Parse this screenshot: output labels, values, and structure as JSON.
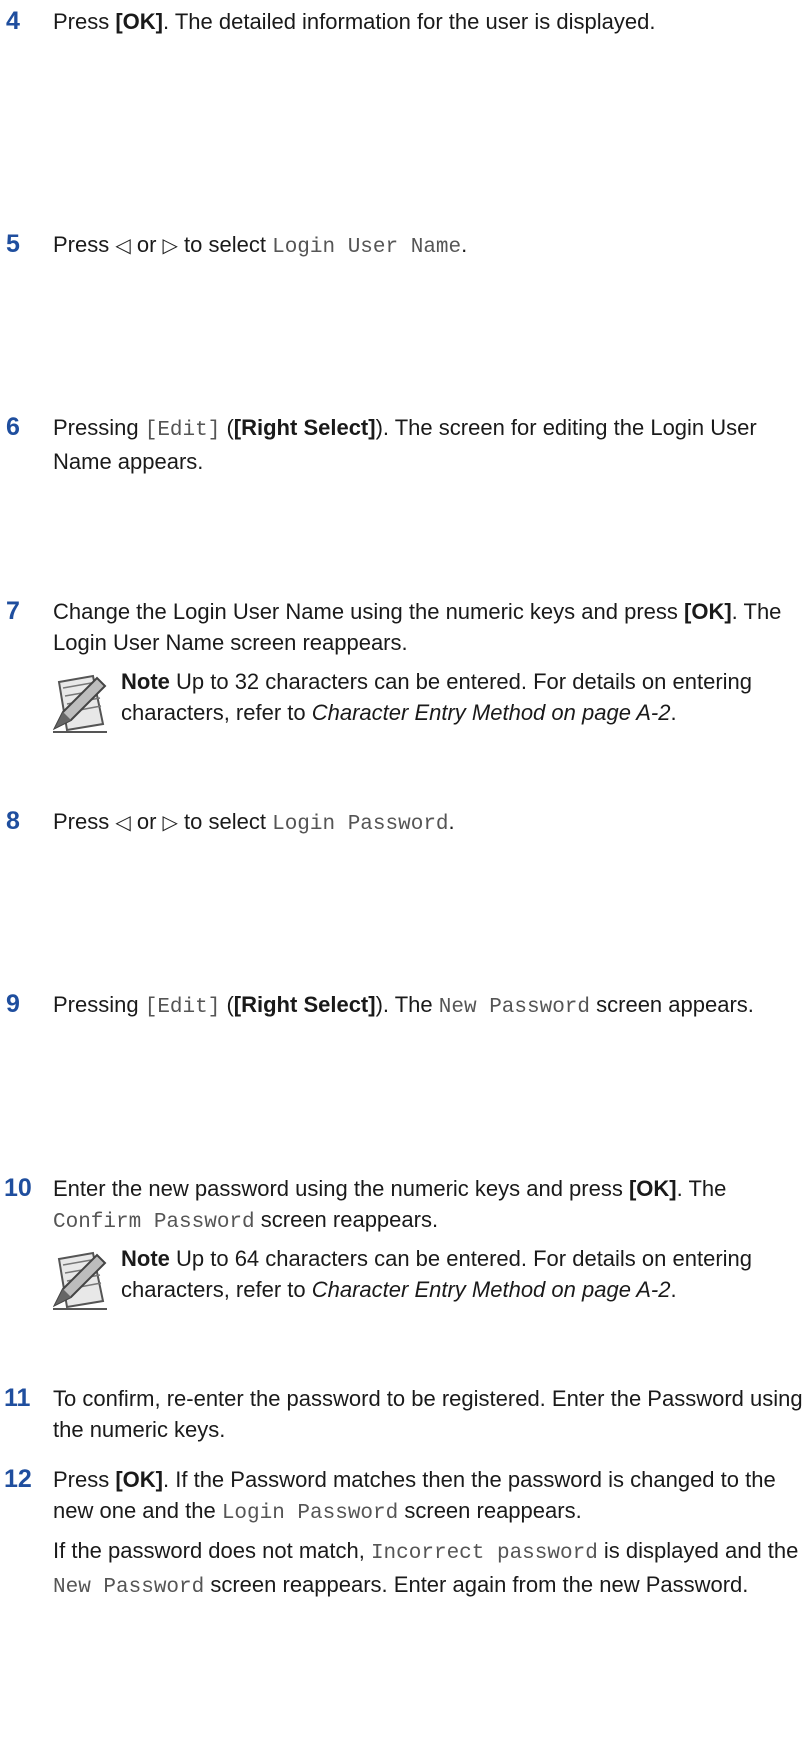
{
  "steps": {
    "s4": {
      "num": "4",
      "a": "Press ",
      "b": "[OK]",
      "c": ". The detailed information for the user is displayed."
    },
    "s5": {
      "num": "5",
      "a": "Press ",
      "left": "◁",
      "or": " or ",
      "right": "▷",
      "c": " to select ",
      "mono": "Login User Name",
      "d": "."
    },
    "s6": {
      "num": "6",
      "a": "Pressing ",
      "mono": "[Edit]",
      "b": " (",
      "bold": "[Right Select]",
      "c": "). The screen for editing the Login User Name appears."
    },
    "s7": {
      "num": "7",
      "a": "Change the Login User Name using the numeric keys and press ",
      "bold": "[OK]",
      "c": ". The Login User Name screen reappears."
    },
    "n1": {
      "label": "Note",
      "a": "  Up to 32 characters can be entered. For details on entering characters, refer to ",
      "ital": "Character Entry Method on page A-2",
      "c": "."
    },
    "s8": {
      "num": "8",
      "a": "Press ",
      "left": "◁",
      "or": " or ",
      "right": "▷",
      "c": " to select ",
      "mono": "Login Password",
      "d": "."
    },
    "s9": {
      "num": "9",
      "a": "Pressing ",
      "mono": "[Edit]",
      "b": " (",
      "bold": "[Right Select]",
      "c": "). The ",
      "mono2": "New Password",
      "d": " screen appears."
    },
    "s10": {
      "num": "10",
      "a": "Enter the new password using the numeric keys and press ",
      "bold": "[OK]",
      "c": ". The ",
      "mono": "Confirm Password",
      "d": " screen reappears."
    },
    "n2": {
      "label": "Note",
      "a": "  Up to 64 characters can be entered. For details on entering characters, refer to ",
      "ital": "Character Entry Method on page A-2",
      "c": "."
    },
    "s11": {
      "num": "11",
      "a": "To confirm, re-enter the password to be registered. Enter the Password using the numeric keys."
    },
    "s12": {
      "num": "12",
      "a": "Press ",
      "bold": "[OK]",
      "c": ". If the Password matches then the password is changed to the new one and the ",
      "mono": "Login Password",
      "d": " screen reappears."
    },
    "s12b": {
      "a": "If the password does not match, ",
      "mono": "Incorrect password",
      "b": " is displayed and the ",
      "mono2": "New Password",
      "c": " screen reappears. Enter again from the new Password."
    }
  },
  "icons": {
    "note": "note-pad-pencil-icon"
  },
  "colors": {
    "step_number": "#1f4e9e",
    "text": "#1a1a1a"
  }
}
